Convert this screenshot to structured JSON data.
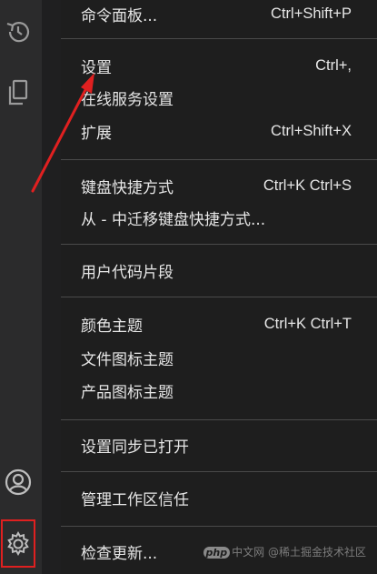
{
  "activity_bar": {
    "icons": [
      "history-icon",
      "copy-icon",
      "account-icon",
      "gear-icon"
    ]
  },
  "menu": {
    "groups": [
      [
        {
          "label": "命令面板...",
          "shortcut": "Ctrl+Shift+P"
        }
      ],
      [
        {
          "label": "设置",
          "shortcut": "Ctrl+,"
        },
        {
          "label": "在线服务设置",
          "shortcut": ""
        },
        {
          "label": "扩展",
          "shortcut": "Ctrl+Shift+X"
        }
      ],
      [
        {
          "label": "键盘快捷方式",
          "shortcut": "Ctrl+K Ctrl+S"
        },
        {
          "label": "从 - 中迁移键盘快捷方式...",
          "shortcut": ""
        }
      ],
      [
        {
          "label": "用户代码片段",
          "shortcut": ""
        }
      ],
      [
        {
          "label": "颜色主题",
          "shortcut": "Ctrl+K Ctrl+T"
        },
        {
          "label": "文件图标主题",
          "shortcut": ""
        },
        {
          "label": "产品图标主题",
          "shortcut": ""
        }
      ],
      [
        {
          "label": "设置同步已打开",
          "shortcut": ""
        }
      ],
      [
        {
          "label": "管理工作区信任",
          "shortcut": ""
        }
      ],
      [
        {
          "label": "检查更新...",
          "shortcut": ""
        }
      ]
    ]
  },
  "watermark": {
    "logo": "php",
    "text": "中文网",
    "credit": "@稀土掘金技术社区"
  },
  "colors": {
    "menu_bg": "#1e1e1e",
    "activity_bg": "#2b2b2c",
    "highlight_red": "#e02020",
    "text": "#e6e6e6"
  }
}
